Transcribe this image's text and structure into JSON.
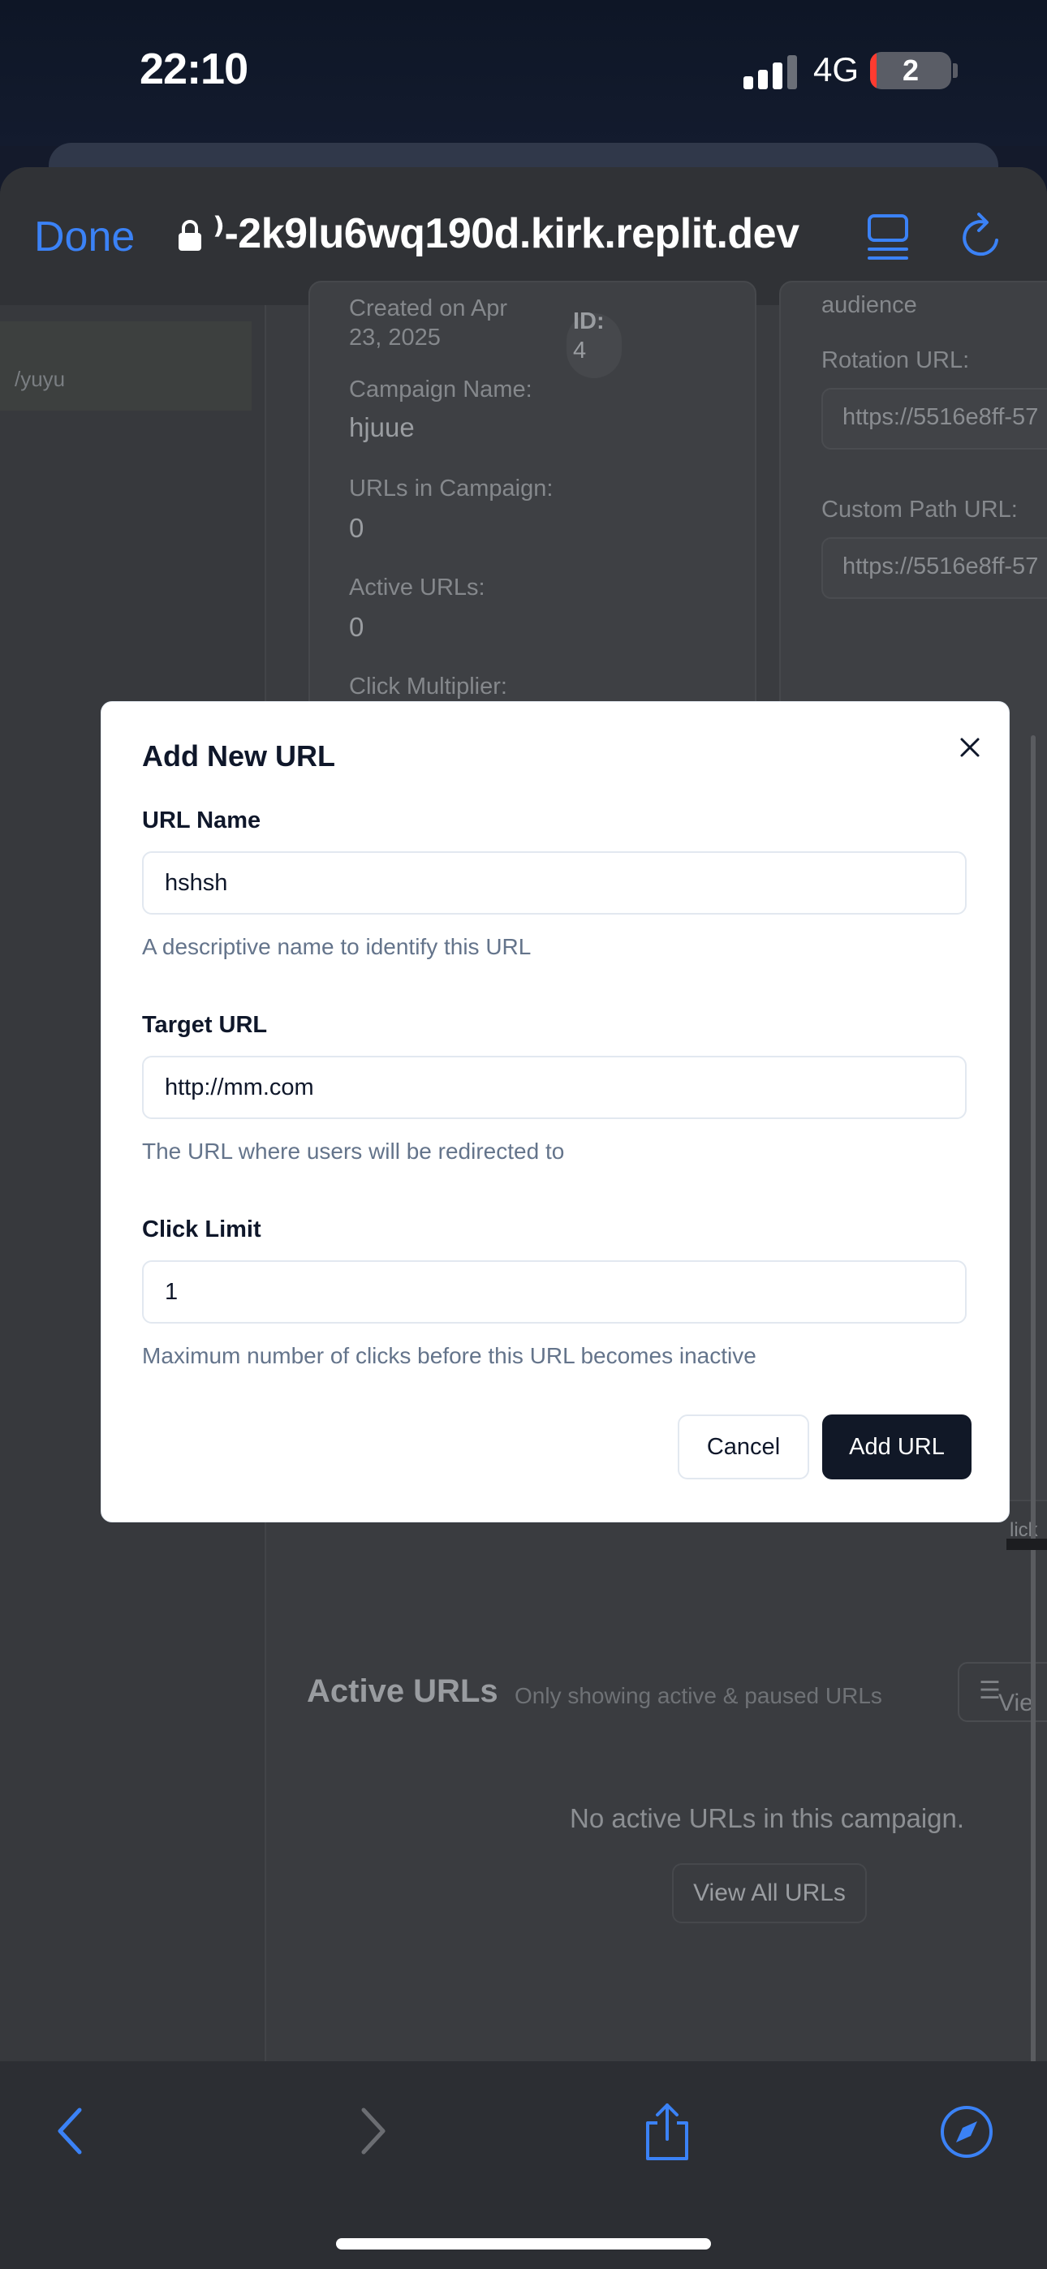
{
  "status_bar": {
    "time": "22:10",
    "network": "4G",
    "battery": "2"
  },
  "browser": {
    "done_label": "Done",
    "url": "⁾-2k9lu6wq190d.kirk.replit.dev",
    "icons": [
      "lock-icon",
      "reader-mode-icon",
      "reload-icon"
    ]
  },
  "background_page": {
    "sidebar_item": "/yuyu",
    "campaign_card": {
      "created_label": "Created on Apr",
      "created_date": "23, 2025",
      "id_label": "ID:",
      "id_value": "4",
      "campaign_name_label": "Campaign Name:",
      "campaign_name": "hjuue",
      "urls_label": "URLs in Campaign:",
      "urls_value": "0",
      "active_urls_label": "Active URLs:",
      "active_urls_value": "0",
      "click_multiplier_label": "Click Multiplier:"
    },
    "links_card": {
      "audience_label": "audience",
      "rotation_label": "Rotation URL:",
      "rotation_value": "https://5516e8ff-57",
      "custom_path_label": "Custom Path URL:",
      "custom_path_value": "https://5516e8ff-57",
      "click_fragment": "lick"
    },
    "active_urls": {
      "title": "Active URLs",
      "subtitle": "Only showing active & paused URLs",
      "view_label": "Vie",
      "empty_message": "No active URLs in this campaign.",
      "view_all_label": "View All URLs"
    }
  },
  "modal": {
    "title": "Add New URL",
    "url_name": {
      "label": "URL Name",
      "value": "hshsh",
      "help": "A descriptive name to identify this URL"
    },
    "target_url": {
      "label": "Target URL",
      "value": "http://mm.com",
      "help": "The URL where users will be redirected to"
    },
    "click_limit": {
      "label": "Click Limit",
      "value": "1",
      "help": "Maximum number of clicks before this URL becomes inactive"
    },
    "cancel_label": "Cancel",
    "submit_label": "Add URL"
  },
  "toolbar": {
    "icons": [
      "back-icon",
      "forward-icon",
      "share-icon",
      "compass-icon"
    ]
  },
  "colors": {
    "accent": "#3b82f6",
    "primary_button": "#111827"
  }
}
